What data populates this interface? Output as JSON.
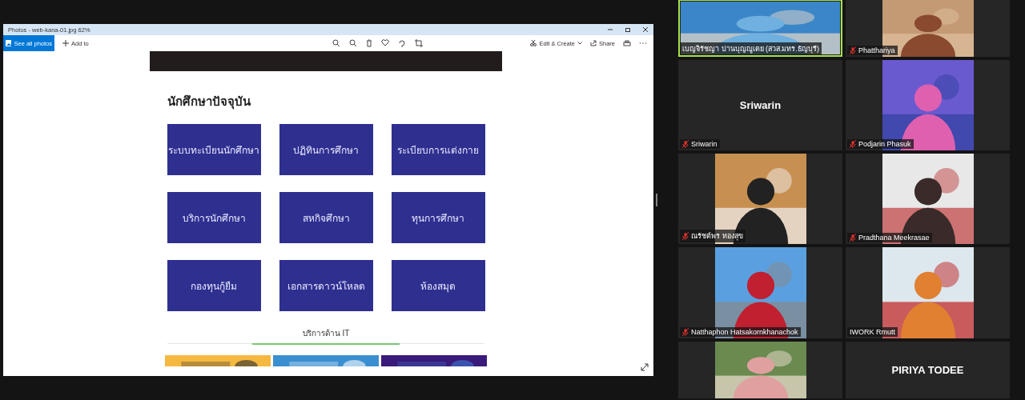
{
  "photos_window": {
    "title": "Photos - web-kana-01.jpg  62%",
    "toolbar": {
      "see_all": "See all photos",
      "add_to": "Add to",
      "edit_create": "Edit & Create",
      "share": "Share"
    },
    "page": {
      "heading": "นักศึกษาปัจจุบัน",
      "buttons": [
        "ระบบทะเบียนนักศึกษา",
        "ปฏิทินการศึกษา",
        "ระเบียบการแต่งกาย",
        "บริการนักศึกษา",
        "สหกิจศึกษา",
        "ทุนการศึกษา",
        "กองทุนกู้ยืม",
        "เอกสารดาวน์โหลด",
        "ห้องสมุด"
      ],
      "section_title": "บริการด้าน IT",
      "banners": [
        {
          "kind": "picture"
        },
        {
          "kind": "picture"
        },
        {
          "kind": "picture"
        }
      ]
    }
  },
  "participants": [
    {
      "kind": "video",
      "label": "เบญจิรัชญา ปานบุญญูเตย (สวส.มทร.ธัญบุรี)",
      "muted": false,
      "speaking": true
    },
    {
      "kind": "video",
      "label": "Phatthariya",
      "muted": true,
      "speaking": false
    },
    {
      "kind": "name_only",
      "big_name": "Sriwarin",
      "label": "Sriwarin",
      "muted": true,
      "speaking": false
    },
    {
      "kind": "video",
      "label": "Podjarin Phasuk",
      "muted": true,
      "speaking": false
    },
    {
      "kind": "video",
      "label": "ณรัชต์พร  ทองสุข",
      "muted": true,
      "speaking": false
    },
    {
      "kind": "video",
      "label": "Pradthana Meekrasae",
      "muted": true,
      "speaking": false
    },
    {
      "kind": "video",
      "label": "Natthaphon Hatsakornkhanachok",
      "muted": true,
      "speaking": false
    },
    {
      "kind": "video",
      "label": "IWORK Rmutt",
      "muted": false,
      "speaking": false
    },
    {
      "kind": "video",
      "speaking": false
    },
    {
      "kind": "name_only",
      "big_name": "PIRIYA TODEE",
      "speaking": false
    }
  ]
}
